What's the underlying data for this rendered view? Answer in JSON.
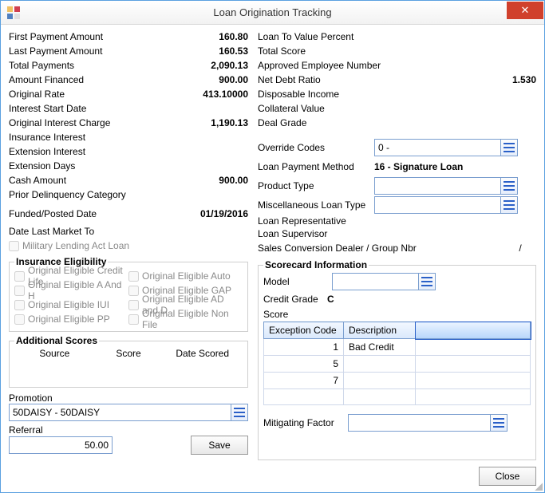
{
  "window": {
    "title": "Loan Origination Tracking",
    "close_glyph": "✕"
  },
  "left": {
    "first_payment_amount": {
      "label": "First Payment Amount",
      "value": "160.80"
    },
    "last_payment_amount": {
      "label": "Last Payment Amount",
      "value": "160.53"
    },
    "total_payments": {
      "label": "Total Payments",
      "value": "2,090.13"
    },
    "amount_financed": {
      "label": "Amount Financed",
      "value": "900.00"
    },
    "original_rate": {
      "label": "Original Rate",
      "value": "413.10000"
    },
    "interest_start_date": {
      "label": "Interest Start Date",
      "value": ""
    },
    "original_interest_charge": {
      "label": "Original Interest Charge",
      "value": "1,190.13"
    },
    "insurance_interest": {
      "label": "Insurance Interest",
      "value": ""
    },
    "extension_interest": {
      "label": "Extension Interest",
      "value": ""
    },
    "extension_days": {
      "label": "Extension Days",
      "value": ""
    },
    "cash_amount": {
      "label": "Cash Amount",
      "value": "900.00"
    },
    "prior_delinquency_category": {
      "label": "Prior Delinquency Category",
      "value": ""
    },
    "funded_posted_date": {
      "label": "Funded/Posted Date",
      "value": "01/19/2016"
    },
    "date_last_market_to": {
      "label": "Date Last Market To",
      "value": ""
    },
    "mla_checkbox_label": "Military Lending Act Loan"
  },
  "insurance_eligibility": {
    "legend": "Insurance Eligibility",
    "items": [
      "Original Eligible Credit Life",
      "Original Eligible Auto",
      "Original Eligible A And H",
      "Original Eligible GAP",
      "Original Eligible IUI",
      "Original Eligible AD and D",
      "Original Eligible PP",
      "Original Eligible Non File"
    ]
  },
  "additional_scores": {
    "legend": "Additional Scores",
    "headers": {
      "source": "Source",
      "score": "Score",
      "date_scored": "Date Scored"
    }
  },
  "promotion": {
    "label": "Promotion",
    "value": "50DAISY - 50DAISY"
  },
  "referral": {
    "label": "Referral",
    "value": "50.00",
    "save_label": "Save"
  },
  "right": {
    "loan_to_value_percent": {
      "label": "Loan To Value Percent",
      "value": ""
    },
    "total_score": {
      "label": "Total Score",
      "value": ""
    },
    "approved_employee_number": {
      "label": "Approved Employee Number",
      "value": ""
    },
    "net_debt_ratio": {
      "label": "Net Debt Ratio",
      "value": "1.530"
    },
    "disposable_income": {
      "label": "Disposable Income",
      "value": ""
    },
    "collateral_value": {
      "label": "Collateral Value",
      "value": ""
    },
    "deal_grade": {
      "label": "Deal Grade",
      "value": ""
    }
  },
  "lookups": {
    "override_codes": {
      "label": "Override Codes",
      "value": "0 -"
    },
    "loan_payment_method": {
      "label": "Loan Payment Method",
      "value": "16 - Signature Loan"
    },
    "product_type": {
      "label": "Product Type",
      "value": ""
    },
    "misc_loan_type": {
      "label": "Miscellaneous Loan Type",
      "value": ""
    },
    "loan_representative": {
      "label": "Loan Representative",
      "value": ""
    },
    "loan_supervisor": {
      "label": "Loan Supervisor",
      "value": ""
    },
    "sales_conversion": {
      "label": "Sales Conversion Dealer / Group Nbr",
      "value": "/"
    }
  },
  "scorecard": {
    "legend": "Scorecard Information",
    "model": {
      "label": "Model",
      "value": ""
    },
    "credit_grade": {
      "label": "Credit Grade",
      "value": "C"
    },
    "score": {
      "label": "Score",
      "value": ""
    },
    "table": {
      "headers": {
        "exception_code": "Exception Code",
        "description": "Description"
      },
      "rows": [
        {
          "code": "1",
          "desc": "Bad Credit"
        },
        {
          "code": "5",
          "desc": ""
        },
        {
          "code": "7",
          "desc": ""
        }
      ]
    },
    "mitigating_factor": {
      "label": "Mitigating Factor",
      "value": ""
    }
  },
  "buttons": {
    "close": "Close"
  }
}
